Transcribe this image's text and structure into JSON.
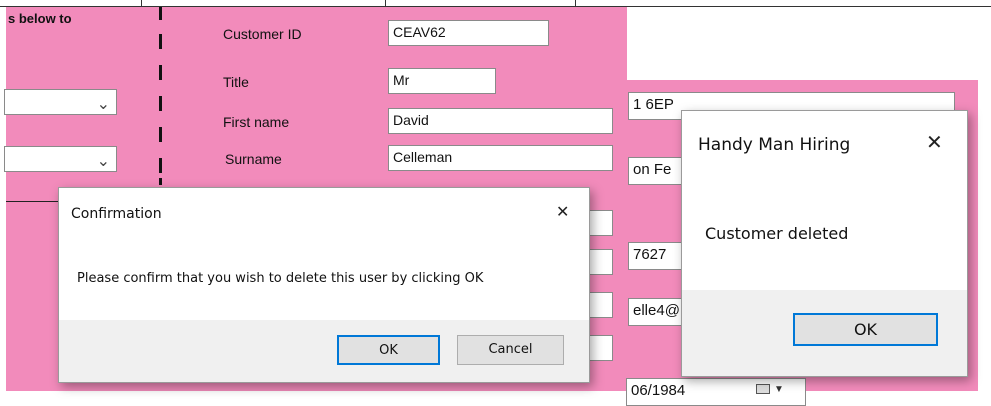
{
  "form": {
    "heading_fragment": "s below to",
    "customer_id_label": "Customer ID",
    "customer_id_value": "CEAV62",
    "title_label": "Title",
    "title_value": "Mr",
    "first_name_label": "First name",
    "first_name_value": "David",
    "surname_label": "Surname",
    "surname_value": "Celleman"
  },
  "right_form": {
    "postcode_fragment": "1 6EP",
    "street_fragment": "on Fe",
    "phone_fragment": "7627",
    "email_fragment": "elle4@",
    "date_fragment": "06/1984"
  },
  "confirm_dialog": {
    "title": "Confirmation",
    "message": "Please confirm that you wish to delete this user by clicking OK",
    "ok_label": "OK",
    "cancel_label": "Cancel",
    "close_glyph": "✕"
  },
  "info_dialog": {
    "title": "Handy Man Hiring",
    "message": "Customer deleted",
    "ok_label": "OK",
    "close_glyph": "✕"
  }
}
